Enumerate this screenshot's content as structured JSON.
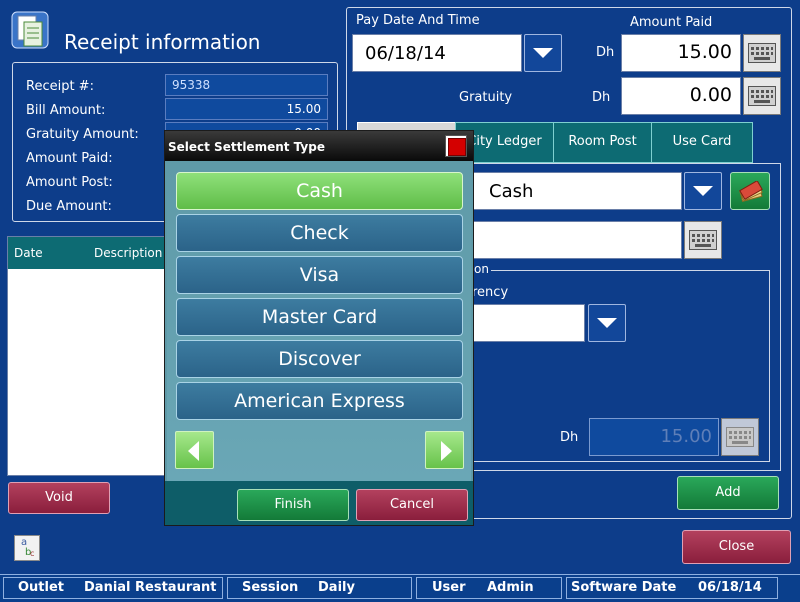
{
  "header": {
    "title": "Receipt information"
  },
  "left": {
    "labels": [
      "Receipt #:",
      "Bill Amount:",
      "Gratuity Amount:",
      "Amount Paid:",
      "Amount Post:",
      "Due Amount:"
    ],
    "receipt_no": "95338",
    "bill_amount": "15.00",
    "gratuity_amount": "0.00",
    "table_headers": [
      "Date",
      "Description"
    ],
    "void_label": "Void"
  },
  "right": {
    "pay_date_label": "Pay Date And Time",
    "pay_date_value": "06/18/14",
    "amount_paid_label": "Amount Paid",
    "currency": "Dh",
    "amount_paid_value": "15.00",
    "gratuity_label": "Gratuity",
    "gratuity_value": "0.00",
    "tabs": [
      "City Ledger",
      "Room Post",
      "Use Card"
    ],
    "settlement_value": "Cash",
    "group_partial_title": "on",
    "currency_partial_label": "rency",
    "amount_currency": "Dh",
    "amount_value": "15.00",
    "add_label": "Add",
    "close_label": "Close"
  },
  "dialog": {
    "title": "Select Settlement Type",
    "options": [
      "Cash",
      "Check",
      "Visa",
      "Master Card",
      "Discover",
      "American Express"
    ],
    "selected": "Cash",
    "finish_label": "Finish",
    "cancel_label": "Cancel"
  },
  "status": {
    "outlet_label": "Outlet",
    "outlet_value": "Danial Restaurant",
    "session_label": "Session",
    "session_value": "Daily",
    "user_label": "User",
    "user_value": "Admin",
    "software_date_label": "Software Date",
    "software_date_value": "06/18/14"
  },
  "colors": {
    "background": "#0d3d8a",
    "teal": "#0d6b73",
    "green": "#2aa85a",
    "red": "#8a1e3c",
    "option_selected": "#6fcb55"
  }
}
